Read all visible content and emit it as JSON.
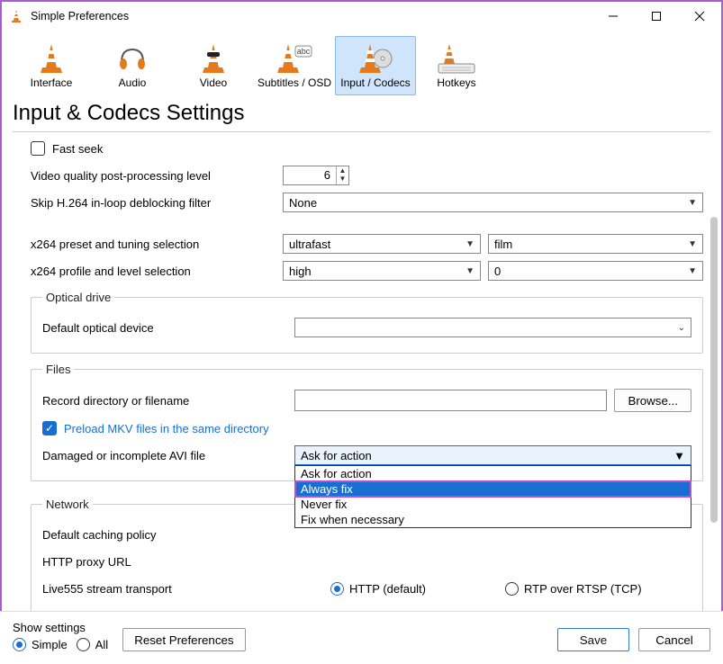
{
  "window": {
    "title": "Simple Preferences"
  },
  "tabs": [
    "Interface",
    "Audio",
    "Video",
    "Subtitles / OSD",
    "Input / Codecs",
    "Hotkeys"
  ],
  "page_heading": "Input & Codecs Settings",
  "codecs": {
    "fast_seek": "Fast seek",
    "vqpp_label": "Video quality post-processing level",
    "vqpp_value": "6",
    "skip_label": "Skip H.264 in-loop deblocking filter",
    "skip_value": "None",
    "x264_preset_label": "x264 preset and tuning selection",
    "x264_preset": "ultrafast",
    "x264_tuning": "film",
    "x264_profile_label": "x264 profile and level selection",
    "x264_profile": "high",
    "x264_level": "0"
  },
  "optical": {
    "legend": "Optical drive",
    "default_label": "Default optical device",
    "default_value": ""
  },
  "files": {
    "legend": "Files",
    "record_label": "Record directory or filename",
    "record_value": "",
    "browse": "Browse...",
    "preload_label": "Preload MKV files in the same directory",
    "avi_label": "Damaged or incomplete AVI file",
    "avi_selected": "Ask for action",
    "avi_options": [
      "Ask for action",
      "Always fix",
      "Never fix",
      "Fix when necessary"
    ]
  },
  "network": {
    "legend": "Network",
    "caching_label": "Default caching policy",
    "proxy_label": "HTTP proxy URL",
    "live555_label": "Live555 stream transport",
    "http_opt": "HTTP (default)",
    "rtp_opt": "RTP over RTSP (TCP)"
  },
  "footer": {
    "show_settings": "Show settings",
    "simple": "Simple",
    "all": "All",
    "reset": "Reset Preferences",
    "save": "Save",
    "cancel": "Cancel"
  }
}
